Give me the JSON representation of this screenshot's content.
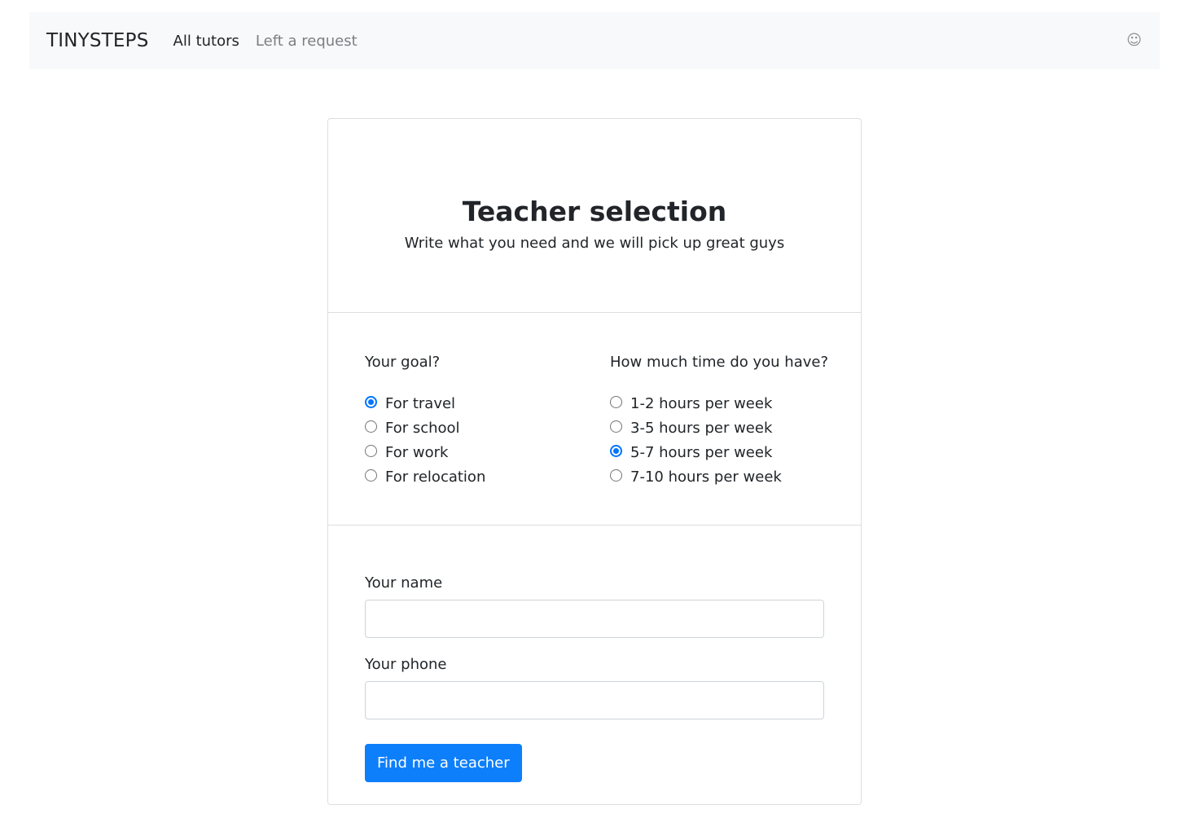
{
  "navbar": {
    "brand": "TINYSTEPS",
    "links": [
      {
        "label": "All tutors",
        "active": true
      },
      {
        "label": "Left a request",
        "active": false
      }
    ],
    "smile_icon": "☺"
  },
  "header": {
    "title": "Teacher selection",
    "subtitle": "Write what you need and we will pick up great guys"
  },
  "goal": {
    "title": "Your goal?",
    "options": [
      "For travel",
      "For school",
      "For work",
      "For relocation"
    ],
    "selected": "For travel"
  },
  "time": {
    "title": "How much time do you have?",
    "options": [
      "1-2 hours per week",
      "3-5 hours per week",
      "5-7 hours per week",
      "7-10 hours per week"
    ],
    "selected": "5-7 hours per week"
  },
  "form": {
    "name_label": "Your name",
    "name_value": "",
    "phone_label": "Your phone",
    "phone_value": "",
    "submit_label": "Find me a teacher"
  },
  "colors": {
    "primary": "#0d7ffb",
    "navbar_bg": "#f8f9fa",
    "radio_checked": "#0075ff"
  }
}
